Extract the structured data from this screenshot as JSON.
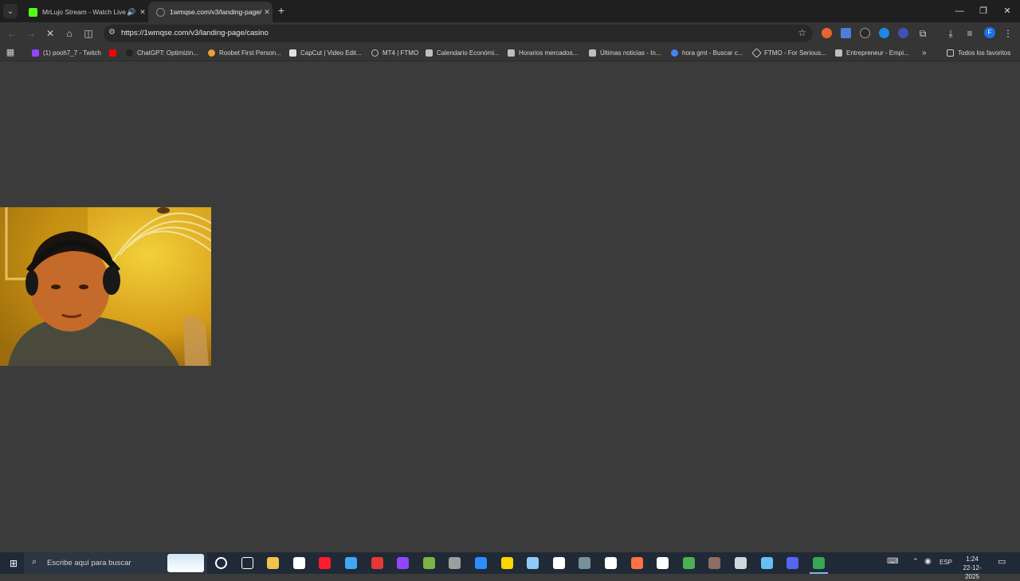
{
  "tabs": [
    {
      "title": "MrLujo Stream - Watch Live",
      "favicon_color": "#53fc18",
      "active": false
    },
    {
      "title": "1wmqse.com/v3/landing-page/",
      "favicon_color": "#8a8a8a",
      "active": true
    }
  ],
  "address_bar": {
    "url": "https://1wmqse.com/v3/landing-page/casino"
  },
  "bookmarks": [
    {
      "label": "(1) pooh7_7 - Twitch",
      "color": "#9146ff"
    },
    {
      "label": "",
      "color": "#ff0000"
    },
    {
      "label": "ChatGPT: Optimizin...",
      "color": "#222222"
    },
    {
      "label": "Roobet First Person...",
      "color": "#e8a13a"
    },
    {
      "label": "CapCut | Video Edit...",
      "color": "#e0e0e0"
    },
    {
      "label": "MT4 | FTMO",
      "color": "#bfbfbf"
    },
    {
      "label": "Calendario Económi...",
      "color": "#bfbfbf"
    },
    {
      "label": "Horarios mercados...",
      "color": "#bfbfbf"
    },
    {
      "label": "Últimas noticias - In...",
      "color": "#bfbfbf"
    },
    {
      "label": "hora gmt - Buscar c...",
      "color": "#4285f4"
    },
    {
      "label": "FTMO - For Serious...",
      "color": "#bfbfbf"
    },
    {
      "label": "Entrepreneur - Empi...",
      "color": "#bfbfbf"
    }
  ],
  "all_bookmarks_label": "Todos los favoritos",
  "taskbar": {
    "search_placeholder": "Escribe aquí para buscar",
    "language": "ESP",
    "time": "1:24",
    "date": "22-12-2025",
    "apps": [
      {
        "name": "cortana",
        "color": "#ffffff"
      },
      {
        "name": "task-view",
        "color": "#ffffff"
      },
      {
        "name": "file-explorer",
        "color": "#f2c14e"
      },
      {
        "name": "notepad",
        "color": "#ffffff"
      },
      {
        "name": "opera",
        "color": "#ff1b2d"
      },
      {
        "name": "copilot",
        "color": "#3fa9f5"
      },
      {
        "name": "app-red",
        "color": "#e53935"
      },
      {
        "name": "twitch",
        "color": "#9146ff"
      },
      {
        "name": "app-green",
        "color": "#7cb342"
      },
      {
        "name": "calculator",
        "color": "#9e9e9e"
      },
      {
        "name": "zoom",
        "color": "#2d8cff"
      },
      {
        "name": "sticky-notes",
        "color": "#ffd600"
      },
      {
        "name": "app-blue",
        "color": "#90caf9"
      },
      {
        "name": "capcut",
        "color": "#ffffff"
      },
      {
        "name": "app-dark",
        "color": "#78909c"
      },
      {
        "name": "settings",
        "color": "#ffffff"
      },
      {
        "name": "app-orange",
        "color": "#ff7043"
      },
      {
        "name": "tiktok",
        "color": "#ffffff"
      },
      {
        "name": "minecraft",
        "color": "#4caf50"
      },
      {
        "name": "app-brown",
        "color": "#8d6e63"
      },
      {
        "name": "obs",
        "color": "#cfd8dc"
      },
      {
        "name": "steam",
        "color": "#66c0f4"
      },
      {
        "name": "discord",
        "color": "#5865f2"
      },
      {
        "name": "chrome",
        "color": "#34a853"
      }
    ]
  },
  "colors": {
    "page_bg": "#3b3b3b",
    "chrome_dark": "#1f1f1f",
    "toolbar": "#353535",
    "taskbar": "#202a36"
  }
}
